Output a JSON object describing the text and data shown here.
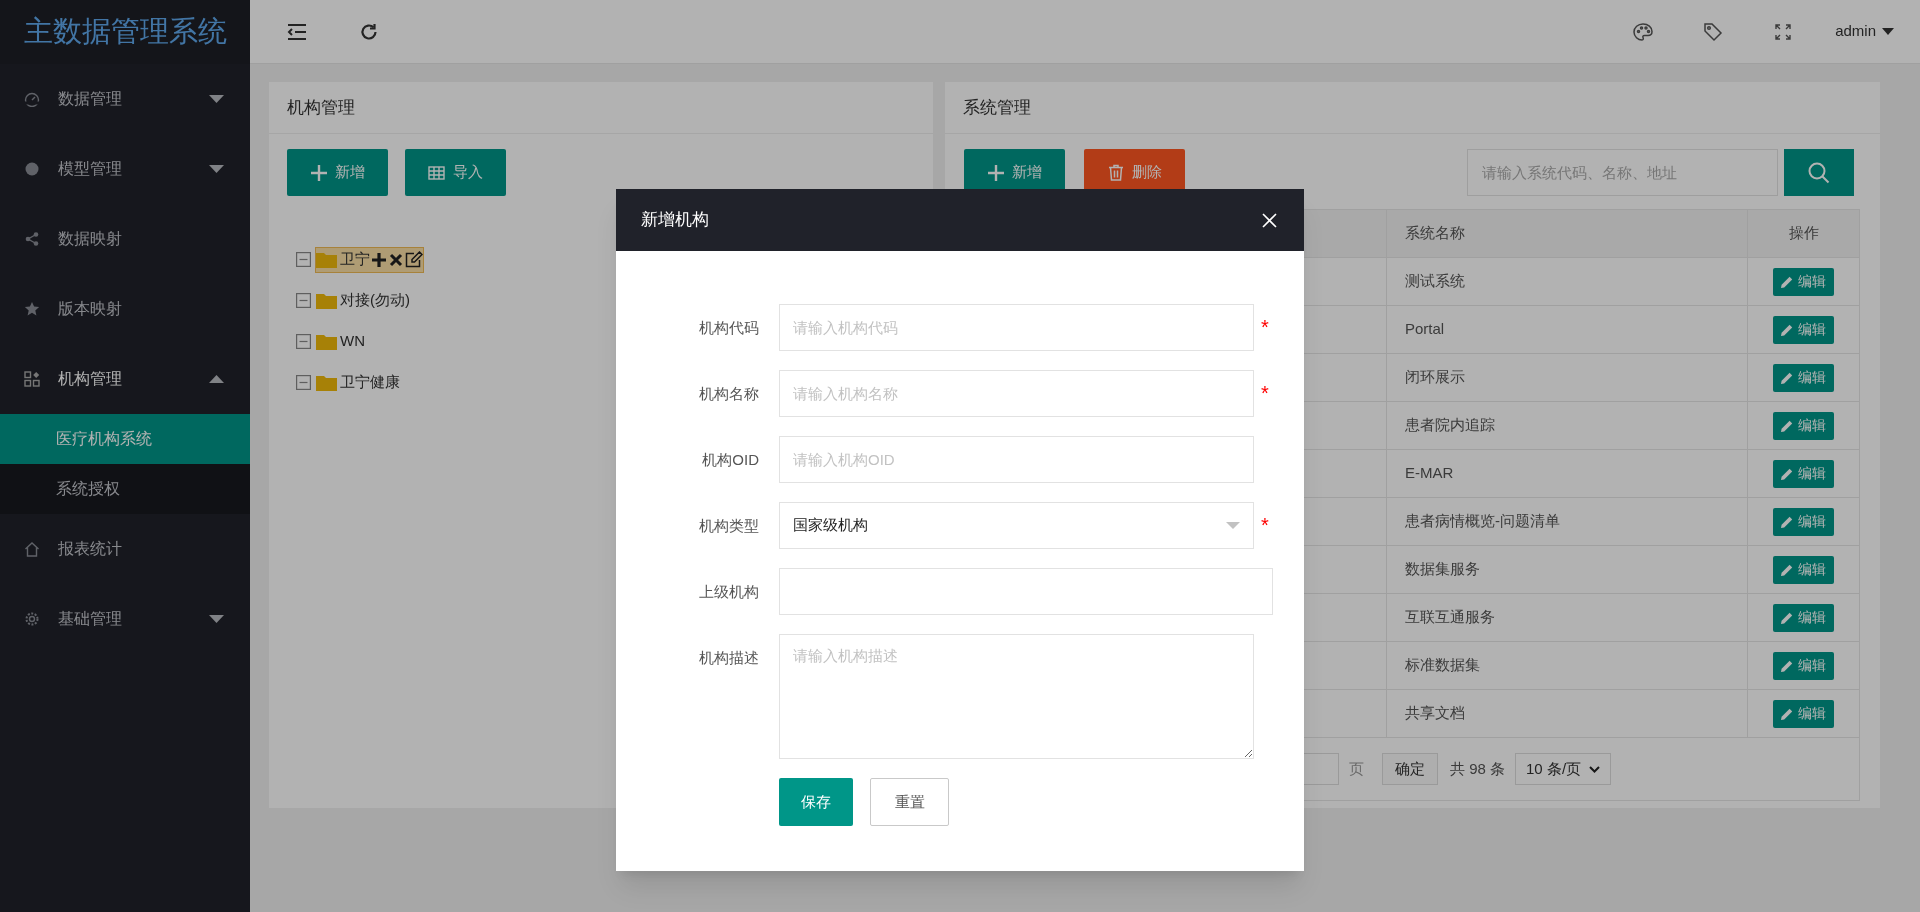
{
  "app_title": "主数据管理系统",
  "header": {
    "user": "admin"
  },
  "sidebar": {
    "items": [
      {
        "label": "数据管理",
        "kind": "group",
        "expanded": false
      },
      {
        "label": "模型管理",
        "kind": "group",
        "expanded": false
      },
      {
        "label": "数据映射",
        "kind": "link"
      },
      {
        "label": "版本映射",
        "kind": "link"
      },
      {
        "label": "机构管理",
        "kind": "group",
        "expanded": true,
        "children": [
          {
            "label": "医疗机构系统",
            "selected": true
          },
          {
            "label": "系统授权",
            "selected": false
          }
        ]
      },
      {
        "label": "报表统计",
        "kind": "link"
      },
      {
        "label": "基础管理",
        "kind": "group",
        "expanded": false
      }
    ]
  },
  "org_panel": {
    "title": "机构管理",
    "buttons": [
      {
        "label": "新增",
        "kind": "add"
      },
      {
        "label": "导入",
        "kind": "import"
      }
    ],
    "tree": [
      {
        "label": "卫宁",
        "expanded": true,
        "selected": true
      },
      {
        "label": "对接(勿动)",
        "expanded": true,
        "selected": false
      },
      {
        "label": "WN",
        "expanded": true,
        "selected": false
      },
      {
        "label": "卫宁健康",
        "expanded": true,
        "selected": false
      }
    ]
  },
  "system_panel": {
    "title": "系统管理",
    "buttons": [
      {
        "label": "新增",
        "kind": "add"
      },
      {
        "label": "删除",
        "kind": "delete"
      }
    ],
    "search": {
      "placeholder": "请输入系统代码、名称、地址"
    },
    "table": {
      "columns": [
        "系统名称",
        "操作"
      ],
      "rows": [
        {
          "name": "测试系统",
          "action": "编辑"
        },
        {
          "name": "Portal",
          "action": "编辑"
        },
        {
          "name": "闭环展示",
          "action": "编辑"
        },
        {
          "name": "患者院内追踪",
          "action": "编辑"
        },
        {
          "name": "E-MAR",
          "action": "编辑"
        },
        {
          "name": "患者病情概览-问题清单",
          "action": "编辑"
        },
        {
          "name": "数据集服务",
          "action": "编辑"
        },
        {
          "name": "互联互通服务",
          "action": "编辑"
        },
        {
          "name": "标准数据集",
          "action": "编辑"
        },
        {
          "name": "共享文档",
          "action": "编辑"
        }
      ]
    },
    "pagination": {
      "page_label": "页",
      "confirm": "确定",
      "total": "共 98 条",
      "page_size": "10 条/页"
    }
  },
  "dialog": {
    "title": "新增机构",
    "fields": [
      {
        "label": "机构代码",
        "kind": "text",
        "placeholder": "请输入机构代码",
        "required_mark": "*"
      },
      {
        "label": "机构名称",
        "kind": "text",
        "placeholder": "请输入机构名称",
        "required_mark": "*"
      },
      {
        "label": "机构OID",
        "kind": "text",
        "placeholder": "请输入机构OID"
      },
      {
        "label": "机构类型",
        "kind": "select",
        "value": "国家级机构",
        "required_mark": "*"
      },
      {
        "label": "上级机构",
        "kind": "wide"
      },
      {
        "label": "机构描述",
        "kind": "textarea",
        "placeholder": "请输入机构描述"
      }
    ],
    "buttons": [
      {
        "label": "保存",
        "kind": "primary"
      },
      {
        "label": "重置",
        "kind": "default"
      }
    ]
  }
}
